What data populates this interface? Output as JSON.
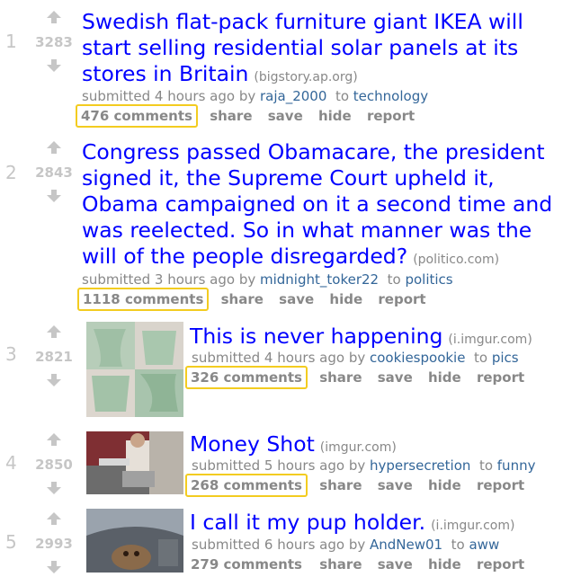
{
  "posts": [
    {
      "rank": "1",
      "score": "3283",
      "title": "Swedish flat-pack furniture giant IKEA will start selling residential solar panels at its stores in Britain",
      "domain": "(bigstory.ap.org)",
      "submitted": "submitted 4 hours ago by",
      "author": "raja_2000",
      "to": "to",
      "subreddit": "technology",
      "comments": "476 comments",
      "share": "share",
      "save": "save",
      "hide": "hide",
      "report": "report"
    },
    {
      "rank": "2",
      "score": "2843",
      "title": "Congress passed Obamacare, the president signed it, the Supreme Court upheld it, Obama campaigned on it a second time and was reelected. So in what manner was the will of the people disregarded?",
      "domain": "(politico.com)",
      "submitted": "submitted 3 hours ago by",
      "author": "midnight_toker22",
      "to": "to",
      "subreddit": "politics",
      "comments": "1118 comments",
      "share": "share",
      "save": "save",
      "hide": "hide",
      "report": "report"
    },
    {
      "rank": "3",
      "score": "2821",
      "title": "This is never happening",
      "domain": "(i.imgur.com)",
      "submitted": "submitted 4 hours ago by",
      "author": "cookiespookie",
      "to": "to",
      "subreddit": "pics",
      "comments": "326 comments",
      "share": "share",
      "save": "save",
      "hide": "hide",
      "report": "report"
    },
    {
      "rank": "4",
      "score": "2850",
      "title": "Money Shot",
      "domain": "(imgur.com)",
      "submitted": "submitted 5 hours ago by",
      "author": "hypersecretion",
      "to": "to",
      "subreddit": "funny",
      "comments": "268 comments",
      "share": "share",
      "save": "save",
      "hide": "hide",
      "report": "report"
    },
    {
      "rank": "5",
      "score": "2993",
      "title": "I call it my pup holder.",
      "domain": "(i.imgur.com)",
      "submitted": "submitted 6 hours ago by",
      "author": "AndNew01",
      "to": "to",
      "subreddit": "aww",
      "comments": "279 comments",
      "share": "share",
      "save": "save",
      "hide": "hide",
      "report": "report"
    }
  ],
  "colors": {
    "title": "#0000ff",
    "meta": "#888888",
    "link": "#336699",
    "highlight": "#f3cc20",
    "score": "#c6c6c6"
  },
  "icons": {
    "upvote": "upvote-arrow-icon",
    "downvote": "downvote-arrow-icon"
  }
}
